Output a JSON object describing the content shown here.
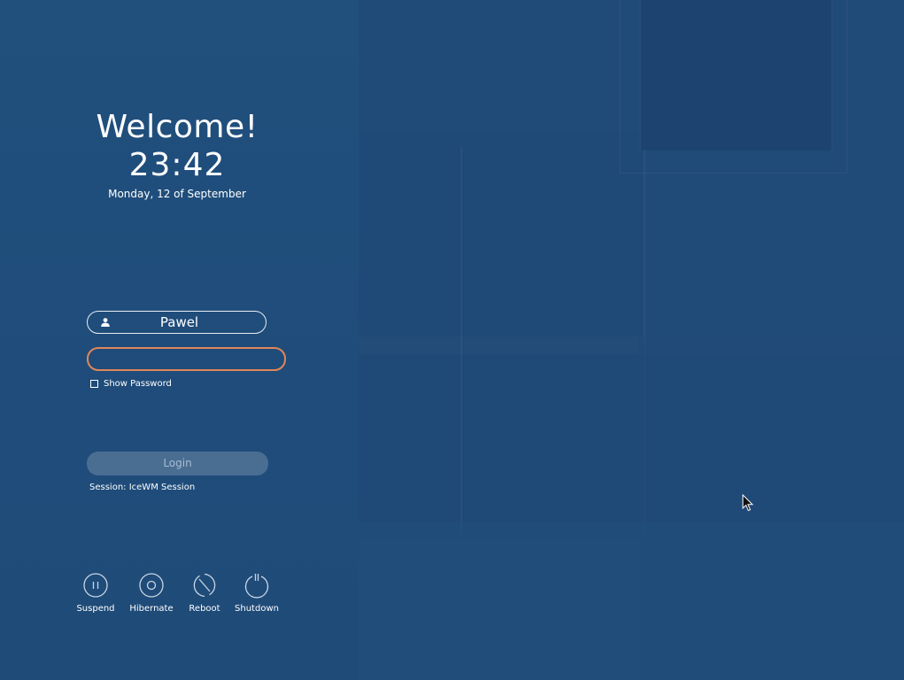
{
  "greeter": {
    "welcome": "Welcome!",
    "time": "23:42",
    "date": "Monday, 12 of September"
  },
  "login": {
    "username": "Pawel",
    "password_value": "",
    "show_password_label": "Show Password",
    "show_password_checked": false,
    "login_label": "Login",
    "session_text": "Session: IceWM Session"
  },
  "power": {
    "suspend_label": "Suspend",
    "hibernate_label": "Hibernate",
    "reboot_label": "Reboot",
    "shutdown_label": "Shutdown"
  },
  "icons": {
    "user": "user-icon",
    "suspend": "pause-circle-icon",
    "hibernate": "hibernate-circle-icon",
    "reboot": "reboot-icon",
    "shutdown": "power-icon",
    "cursor": "mouse-pointer-icon"
  },
  "colors": {
    "background": "#204a78",
    "password_focus_border": "#e0875a",
    "login_button_bg": "#4a6d92",
    "login_button_text": "#a8bdd2"
  }
}
